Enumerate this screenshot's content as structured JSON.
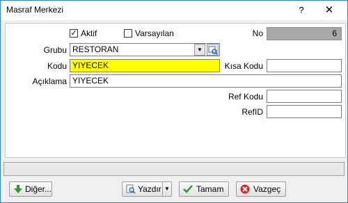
{
  "window": {
    "title": "Masraf Merkezi",
    "help_glyph": "?",
    "close_glyph": "✕"
  },
  "form": {
    "aktif_label": "Aktif",
    "aktif_checked": true,
    "varsayilan_label": "Varsayılan",
    "varsayilan_checked": false,
    "no_label": "No",
    "no_value": "6",
    "grubu_label": "Grubu",
    "grubu_value": "RESTORAN",
    "kodu_label": "Kodu",
    "kodu_value": "YIYECEK",
    "kisa_kodu_label": "Kısa Kodu",
    "kisa_kodu_value": "",
    "aciklama_label": "Açıklama",
    "aciklama_value": "YIYECEK",
    "ref_kodu_label": "Ref Kodu",
    "ref_kodu_value": "",
    "refid_label": "RefID",
    "refid_value": ""
  },
  "status_text": "",
  "buttons": {
    "diger": "Diğer...",
    "yazdir": "Yazdır",
    "tamam": "Tamam",
    "vazgec": "Vazgeç"
  },
  "colors": {
    "kodu_highlight": "#ffff00",
    "no_field_bg": "#a8a8a8",
    "window_border": "#3c7fb1"
  }
}
